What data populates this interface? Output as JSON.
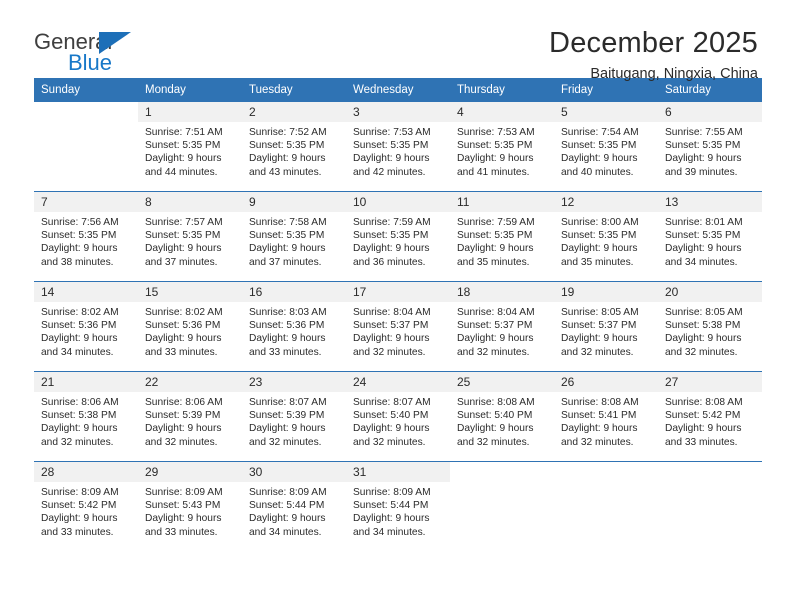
{
  "brand": {
    "name_top": "General",
    "name_bottom": "Blue",
    "accent_color": "#1d6fb8",
    "triangle_icon": "triangle-icon"
  },
  "header": {
    "month_year": "December 2025",
    "location": "Baitugang, Ningxia, China"
  },
  "calendar": {
    "header_bg": "#2f73b4",
    "daynum_bg": "#f1f1f1",
    "weekdays": [
      "Sunday",
      "Monday",
      "Tuesday",
      "Wednesday",
      "Thursday",
      "Friday",
      "Saturday"
    ],
    "weeks": [
      [
        {
          "day": "",
          "sunrise": "",
          "sunset": "",
          "daylight1": "",
          "daylight2": "",
          "blank": true
        },
        {
          "day": "1",
          "sunrise": "Sunrise: 7:51 AM",
          "sunset": "Sunset: 5:35 PM",
          "daylight1": "Daylight: 9 hours",
          "daylight2": "and 44 minutes."
        },
        {
          "day": "2",
          "sunrise": "Sunrise: 7:52 AM",
          "sunset": "Sunset: 5:35 PM",
          "daylight1": "Daylight: 9 hours",
          "daylight2": "and 43 minutes."
        },
        {
          "day": "3",
          "sunrise": "Sunrise: 7:53 AM",
          "sunset": "Sunset: 5:35 PM",
          "daylight1": "Daylight: 9 hours",
          "daylight2": "and 42 minutes."
        },
        {
          "day": "4",
          "sunrise": "Sunrise: 7:53 AM",
          "sunset": "Sunset: 5:35 PM",
          "daylight1": "Daylight: 9 hours",
          "daylight2": "and 41 minutes."
        },
        {
          "day": "5",
          "sunrise": "Sunrise: 7:54 AM",
          "sunset": "Sunset: 5:35 PM",
          "daylight1": "Daylight: 9 hours",
          "daylight2": "and 40 minutes."
        },
        {
          "day": "6",
          "sunrise": "Sunrise: 7:55 AM",
          "sunset": "Sunset: 5:35 PM",
          "daylight1": "Daylight: 9 hours",
          "daylight2": "and 39 minutes."
        }
      ],
      [
        {
          "day": "7",
          "sunrise": "Sunrise: 7:56 AM",
          "sunset": "Sunset: 5:35 PM",
          "daylight1": "Daylight: 9 hours",
          "daylight2": "and 38 minutes."
        },
        {
          "day": "8",
          "sunrise": "Sunrise: 7:57 AM",
          "sunset": "Sunset: 5:35 PM",
          "daylight1": "Daylight: 9 hours",
          "daylight2": "and 37 minutes."
        },
        {
          "day": "9",
          "sunrise": "Sunrise: 7:58 AM",
          "sunset": "Sunset: 5:35 PM",
          "daylight1": "Daylight: 9 hours",
          "daylight2": "and 37 minutes."
        },
        {
          "day": "10",
          "sunrise": "Sunrise: 7:59 AM",
          "sunset": "Sunset: 5:35 PM",
          "daylight1": "Daylight: 9 hours",
          "daylight2": "and 36 minutes."
        },
        {
          "day": "11",
          "sunrise": "Sunrise: 7:59 AM",
          "sunset": "Sunset: 5:35 PM",
          "daylight1": "Daylight: 9 hours",
          "daylight2": "and 35 minutes."
        },
        {
          "day": "12",
          "sunrise": "Sunrise: 8:00 AM",
          "sunset": "Sunset: 5:35 PM",
          "daylight1": "Daylight: 9 hours",
          "daylight2": "and 35 minutes."
        },
        {
          "day": "13",
          "sunrise": "Sunrise: 8:01 AM",
          "sunset": "Sunset: 5:35 PM",
          "daylight1": "Daylight: 9 hours",
          "daylight2": "and 34 minutes."
        }
      ],
      [
        {
          "day": "14",
          "sunrise": "Sunrise: 8:02 AM",
          "sunset": "Sunset: 5:36 PM",
          "daylight1": "Daylight: 9 hours",
          "daylight2": "and 34 minutes."
        },
        {
          "day": "15",
          "sunrise": "Sunrise: 8:02 AM",
          "sunset": "Sunset: 5:36 PM",
          "daylight1": "Daylight: 9 hours",
          "daylight2": "and 33 minutes."
        },
        {
          "day": "16",
          "sunrise": "Sunrise: 8:03 AM",
          "sunset": "Sunset: 5:36 PM",
          "daylight1": "Daylight: 9 hours",
          "daylight2": "and 33 minutes."
        },
        {
          "day": "17",
          "sunrise": "Sunrise: 8:04 AM",
          "sunset": "Sunset: 5:37 PM",
          "daylight1": "Daylight: 9 hours",
          "daylight2": "and 32 minutes."
        },
        {
          "day": "18",
          "sunrise": "Sunrise: 8:04 AM",
          "sunset": "Sunset: 5:37 PM",
          "daylight1": "Daylight: 9 hours",
          "daylight2": "and 32 minutes."
        },
        {
          "day": "19",
          "sunrise": "Sunrise: 8:05 AM",
          "sunset": "Sunset: 5:37 PM",
          "daylight1": "Daylight: 9 hours",
          "daylight2": "and 32 minutes."
        },
        {
          "day": "20",
          "sunrise": "Sunrise: 8:05 AM",
          "sunset": "Sunset: 5:38 PM",
          "daylight1": "Daylight: 9 hours",
          "daylight2": "and 32 minutes."
        }
      ],
      [
        {
          "day": "21",
          "sunrise": "Sunrise: 8:06 AM",
          "sunset": "Sunset: 5:38 PM",
          "daylight1": "Daylight: 9 hours",
          "daylight2": "and 32 minutes."
        },
        {
          "day": "22",
          "sunrise": "Sunrise: 8:06 AM",
          "sunset": "Sunset: 5:39 PM",
          "daylight1": "Daylight: 9 hours",
          "daylight2": "and 32 minutes."
        },
        {
          "day": "23",
          "sunrise": "Sunrise: 8:07 AM",
          "sunset": "Sunset: 5:39 PM",
          "daylight1": "Daylight: 9 hours",
          "daylight2": "and 32 minutes."
        },
        {
          "day": "24",
          "sunrise": "Sunrise: 8:07 AM",
          "sunset": "Sunset: 5:40 PM",
          "daylight1": "Daylight: 9 hours",
          "daylight2": "and 32 minutes."
        },
        {
          "day": "25",
          "sunrise": "Sunrise: 8:08 AM",
          "sunset": "Sunset: 5:40 PM",
          "daylight1": "Daylight: 9 hours",
          "daylight2": "and 32 minutes."
        },
        {
          "day": "26",
          "sunrise": "Sunrise: 8:08 AM",
          "sunset": "Sunset: 5:41 PM",
          "daylight1": "Daylight: 9 hours",
          "daylight2": "and 32 minutes."
        },
        {
          "day": "27",
          "sunrise": "Sunrise: 8:08 AM",
          "sunset": "Sunset: 5:42 PM",
          "daylight1": "Daylight: 9 hours",
          "daylight2": "and 33 minutes."
        }
      ],
      [
        {
          "day": "28",
          "sunrise": "Sunrise: 8:09 AM",
          "sunset": "Sunset: 5:42 PM",
          "daylight1": "Daylight: 9 hours",
          "daylight2": "and 33 minutes."
        },
        {
          "day": "29",
          "sunrise": "Sunrise: 8:09 AM",
          "sunset": "Sunset: 5:43 PM",
          "daylight1": "Daylight: 9 hours",
          "daylight2": "and 33 minutes."
        },
        {
          "day": "30",
          "sunrise": "Sunrise: 8:09 AM",
          "sunset": "Sunset: 5:44 PM",
          "daylight1": "Daylight: 9 hours",
          "daylight2": "and 34 minutes."
        },
        {
          "day": "31",
          "sunrise": "Sunrise: 8:09 AM",
          "sunset": "Sunset: 5:44 PM",
          "daylight1": "Daylight: 9 hours",
          "daylight2": "and 34 minutes."
        },
        {
          "day": "",
          "sunrise": "",
          "sunset": "",
          "daylight1": "",
          "daylight2": "",
          "blank": true
        },
        {
          "day": "",
          "sunrise": "",
          "sunset": "",
          "daylight1": "",
          "daylight2": "",
          "blank": true
        },
        {
          "day": "",
          "sunrise": "",
          "sunset": "",
          "daylight1": "",
          "daylight2": "",
          "blank": true
        }
      ]
    ]
  }
}
